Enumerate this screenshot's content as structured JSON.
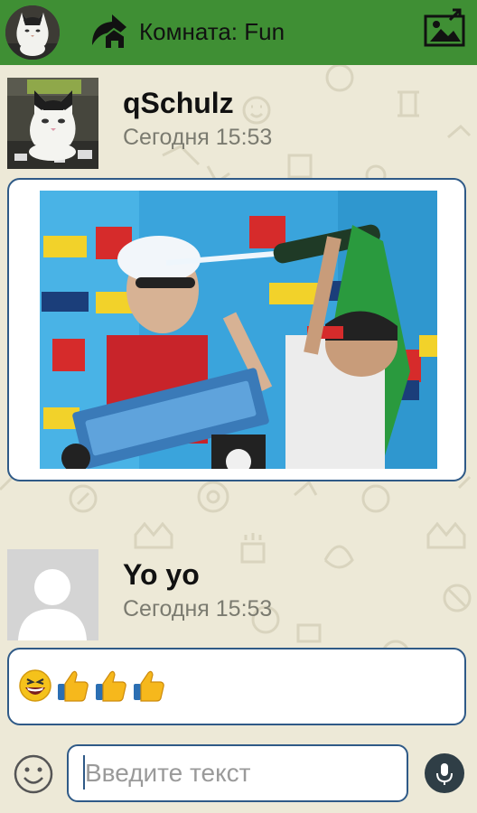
{
  "topbar": {
    "room_title": "Комната: Fun",
    "color": "#3f8f34"
  },
  "messages": [
    {
      "sender": "qSchulz",
      "time": "Сегодня 15:53",
      "type": "image",
      "avatar": "cat-photo",
      "image": "surfer-champagne-celebration"
    },
    {
      "sender": "Yo yo",
      "time": "Сегодня 15:53",
      "type": "emoji",
      "avatar": "default-user",
      "emoji": [
        "grinning-face-icon",
        "thumbs-up-icon",
        "thumbs-up-icon",
        "thumbs-up-icon"
      ]
    }
  ],
  "composer": {
    "placeholder": "Введите текст",
    "value": ""
  },
  "colors": {
    "accent_border": "#2f5a87",
    "background": "#ede9d7"
  }
}
